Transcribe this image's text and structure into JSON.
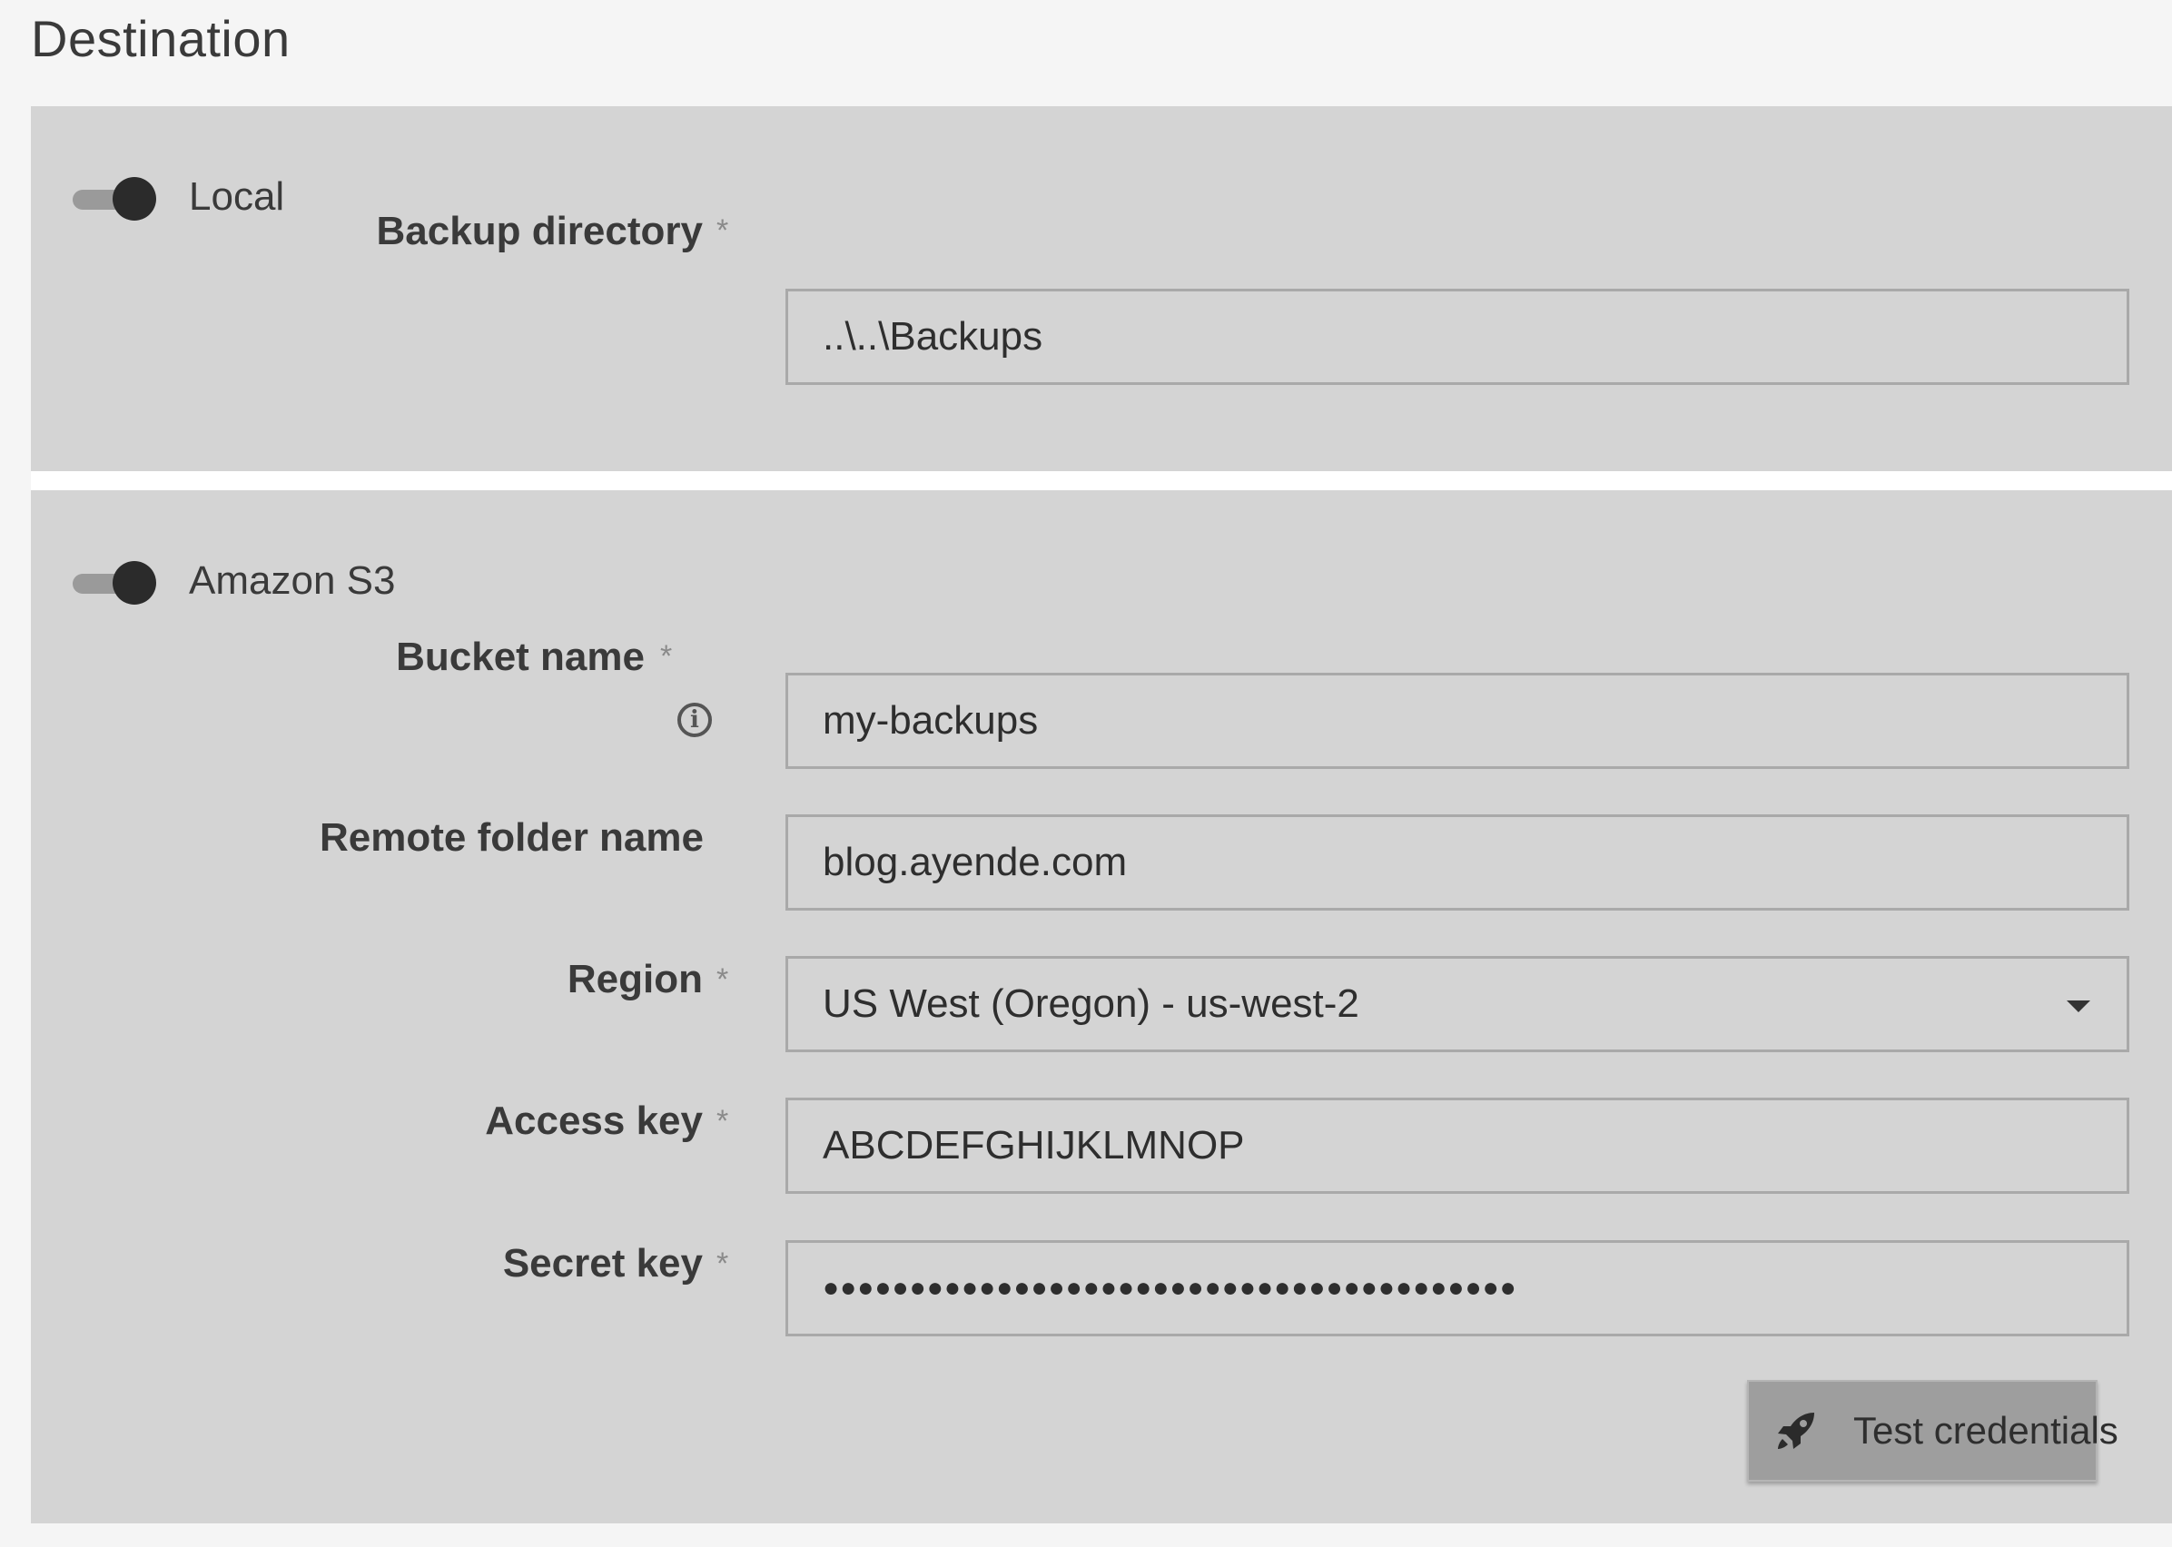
{
  "title": "Destination",
  "local": {
    "toggle_label": "Local",
    "enabled": true,
    "backup_directory": {
      "label": "Backup directory",
      "required_mark": "*",
      "value": "..\\..\\Backups"
    }
  },
  "s3": {
    "toggle_label": "Amazon S3",
    "enabled": true,
    "bucket_name": {
      "label": "Bucket name",
      "required_mark": "*",
      "info_glyph": "i",
      "value": "my-backups"
    },
    "remote_folder": {
      "label": "Remote folder name",
      "value": "blog.ayende.com"
    },
    "region": {
      "label": "Region",
      "required_mark": "*",
      "value": "US West (Oregon) - us-west-2"
    },
    "access_key": {
      "label": "Access key",
      "required_mark": "*",
      "value": "ABCDEFGHIJKLMNOP"
    },
    "secret_key": {
      "label": "Secret key",
      "required_mark": "*",
      "value": "●●●●●●●●●●●●●●●●●●●●●●●●●●●●●●●●●●●●●●●●"
    },
    "test_button": {
      "label": "Test credentials",
      "icon": "rocket-icon"
    }
  }
}
